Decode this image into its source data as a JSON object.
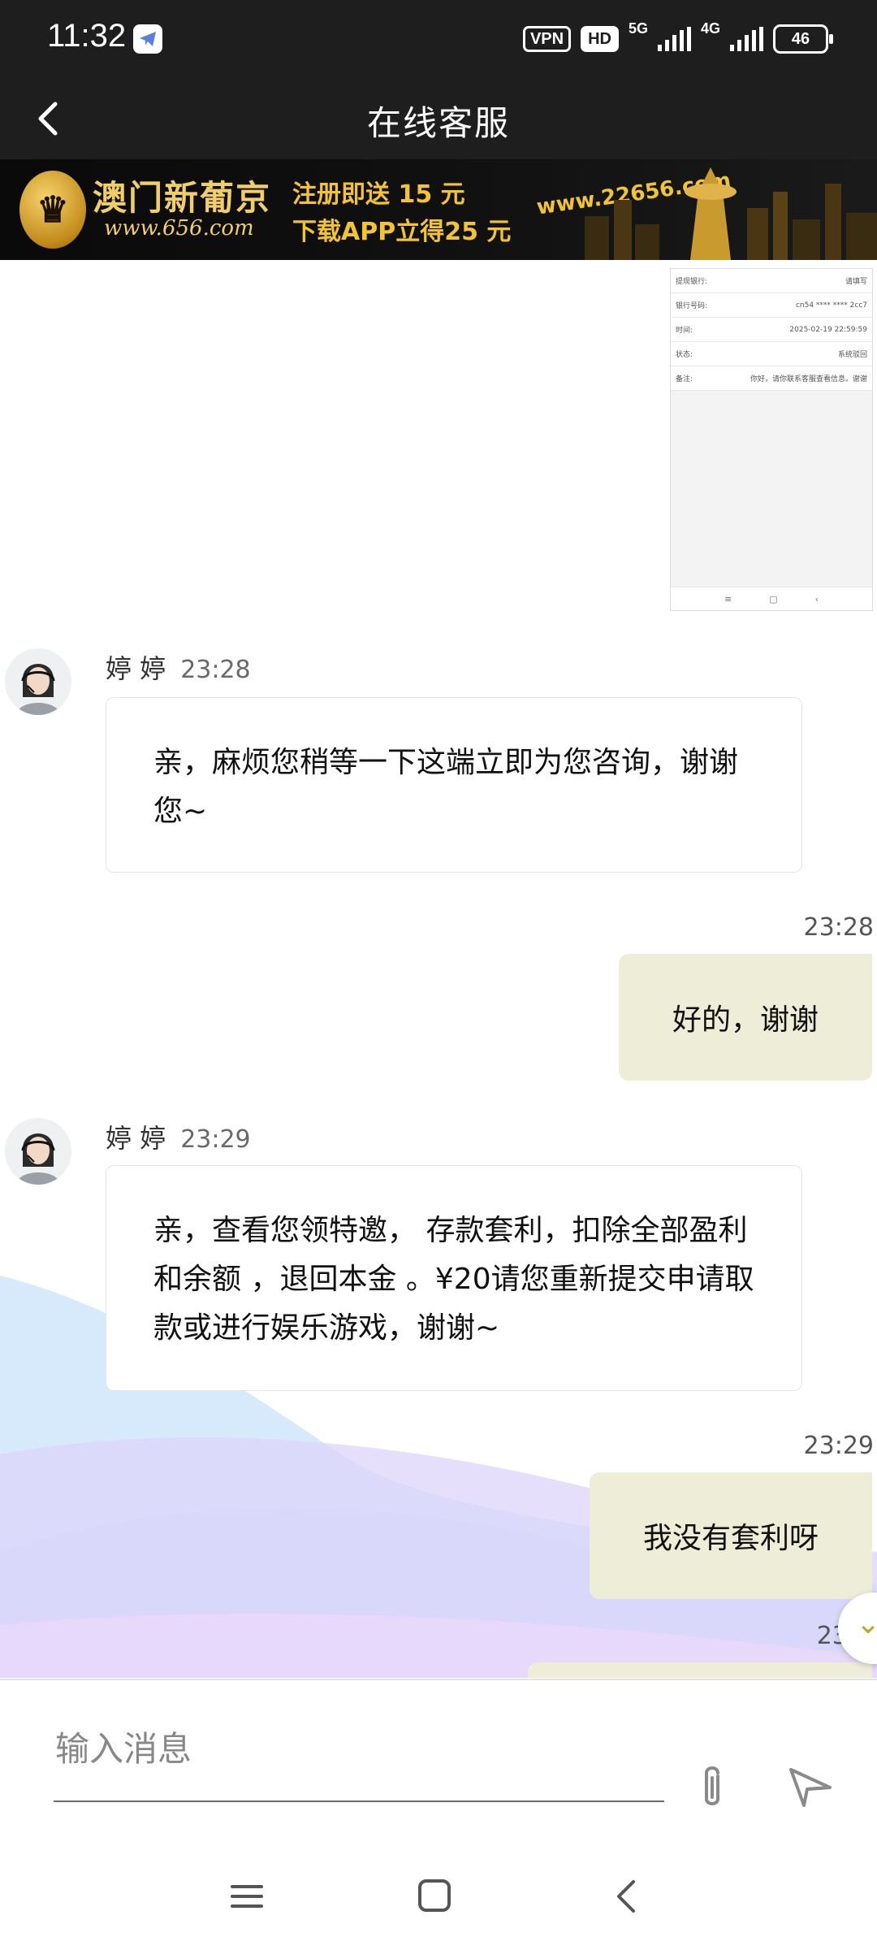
{
  "status_bar": {
    "time": "11:32",
    "vpn": "VPN",
    "hd": "HD",
    "net5g": "5G",
    "net4g": "4G",
    "battery": "46"
  },
  "header": {
    "title": "在线客服"
  },
  "banner": {
    "brand": "澳门新葡京",
    "brand_site": "www.656.com",
    "promo_line1": "注册即送 15 元",
    "promo_line2": "下载APP立得25 元",
    "url": "www.22656.com"
  },
  "screenshot_preview": {
    "rows": [
      {
        "label": "提现银行:",
        "value": "请填写"
      },
      {
        "label": "银行号码:",
        "value": "cn54 **** **** 2cc7"
      },
      {
        "label": "时间:",
        "value": "2025-02-19 22:59:59"
      },
      {
        "label": "状态:",
        "value": "系统驳回"
      },
      {
        "label": "备注:",
        "value": "你好，请你联系客服查看信息。谢谢"
      }
    ]
  },
  "messages": [
    {
      "sender": "婷 婷",
      "time": "23:28",
      "text": "亲，麻烦您稍等一下这端立即为您咨询，谢谢您~"
    },
    {
      "time": "23:28",
      "text": "好的，谢谢"
    },
    {
      "sender": "婷 婷",
      "time": "23:29",
      "text": "亲，查看您领特邀， 存款套利，扣除全部盈利和余额 ，退回本金 。¥20请您重新提交申请取款或进行娱乐游戏，谢谢~"
    },
    {
      "time": "23:29",
      "text": "我没有套利呀"
    },
    {
      "time": "23:"
    }
  ],
  "input": {
    "placeholder": "输入消息"
  },
  "icons": {
    "back": "back-arrow-icon",
    "attach": "paperclip-icon",
    "send": "send-icon",
    "scroll": "scroll-down-icon"
  },
  "colors": {
    "header_bg": "#1e1e1e",
    "outgoing_bubble": "#eeeed8",
    "gold": "#f3c431"
  }
}
